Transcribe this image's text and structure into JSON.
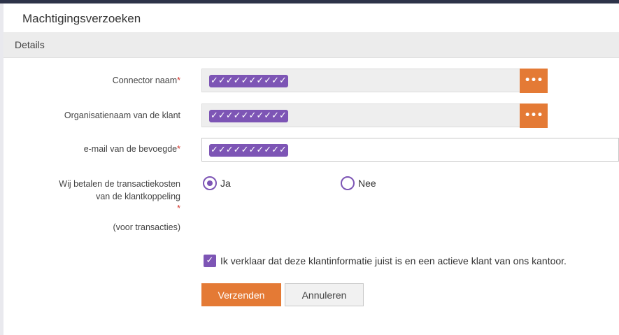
{
  "page": {
    "title": "Machtigingsverzoeken",
    "section_title": "Details"
  },
  "form": {
    "connector_name": {
      "label": "Connector naam",
      "required_mark": "*",
      "value": "✓✓✓✓✓✓✓✓✓✓",
      "lookup_button": "•••"
    },
    "client_org_name": {
      "label": "Organisatienaam van de klant",
      "value": "✓✓✓✓✓✓✓✓✓✓",
      "lookup_button": "•••"
    },
    "authorized_email": {
      "label": "e-mail van de bevoegde",
      "required_mark": "*",
      "value": "✓✓✓✓✓✓✓✓✓✓"
    },
    "transaction_costs": {
      "label_line1": "Wij betalen de transactiekosten",
      "label_line2": "van de klantkoppeling",
      "required_mark": "*",
      "note": "(voor transacties)",
      "options": [
        {
          "label": "Ja",
          "selected": true
        },
        {
          "label": "Nee",
          "selected": false
        }
      ]
    },
    "declaration": {
      "checked": true,
      "check_glyph": "✓",
      "label": "Ik verklaar dat deze klantinformatie juist is en een actieve klant van ons kantoor."
    },
    "buttons": {
      "submit": "Verzenden",
      "cancel": "Annuleren"
    }
  },
  "colors": {
    "accent_orange": "#e47a35",
    "accent_purple": "#7d55b5",
    "top_bar": "#2d3349"
  }
}
